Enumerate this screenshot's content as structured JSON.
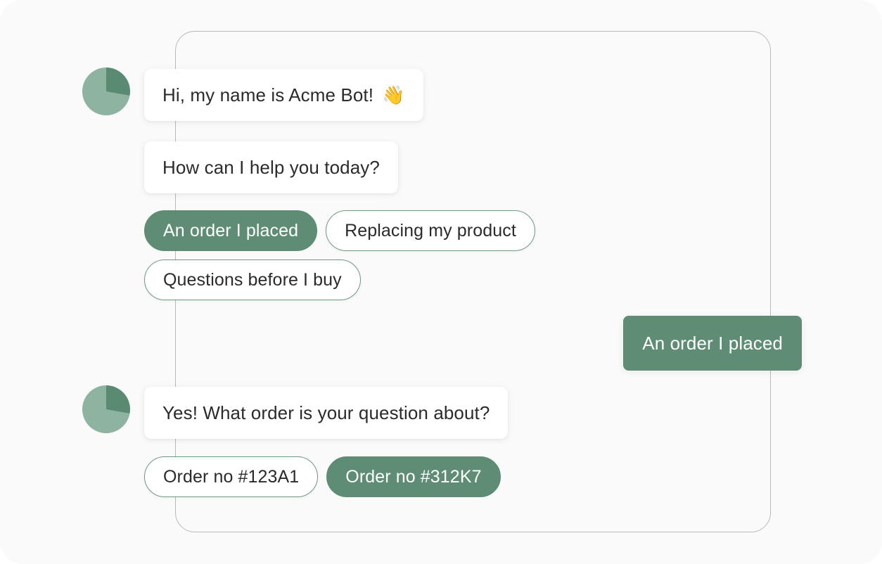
{
  "theme": {
    "page_background": "#FAFAFA",
    "accent_green": "#5F8C74",
    "avatar_light": "#8EB3A0",
    "avatar_dark": "#5B8A72",
    "frame_border": "#B9B9B9",
    "bubble_bot_background": "#FFFFFF",
    "bubble_bot_text": "#2B2B2B",
    "bubble_user_text": "#FFFFFF"
  },
  "conversation": {
    "messages": [
      {
        "id": "bot-greeting",
        "sender": "bot",
        "avatar": "pie-chart-avatar",
        "text": "Hi, my name is Acme Bot!",
        "emoji": "👋",
        "emoji_name": "waving-hand-emoji"
      },
      {
        "id": "bot-help-prompt",
        "sender": "bot",
        "text": "How can I help you today?"
      },
      {
        "id": "user-order-placed",
        "sender": "user",
        "text": "An order I placed"
      },
      {
        "id": "bot-which-order",
        "sender": "bot",
        "avatar": "pie-chart-avatar",
        "text": "Yes! What order is your question about?"
      }
    ],
    "quick_replies_topic": [
      {
        "label": "An order I placed",
        "state": "selected"
      },
      {
        "label": "Replacing my product",
        "state": "default"
      },
      {
        "label": "Questions before I buy",
        "state": "default"
      }
    ],
    "quick_replies_orders": [
      {
        "label": "Order no #123A1",
        "state": "default"
      },
      {
        "label": "Order no #312K7",
        "state": "selected"
      }
    ]
  }
}
